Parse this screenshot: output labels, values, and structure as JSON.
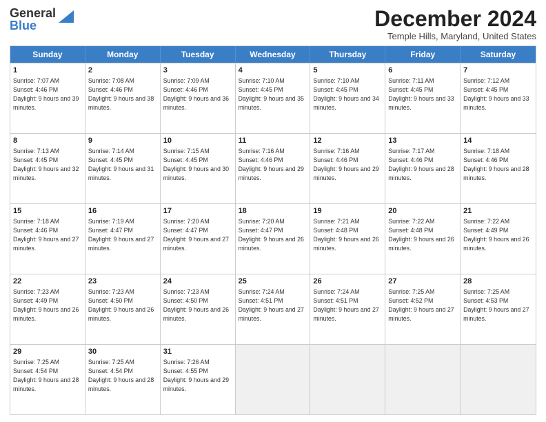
{
  "logo": {
    "general": "General",
    "blue": "Blue"
  },
  "header": {
    "month": "December 2024",
    "location": "Temple Hills, Maryland, United States"
  },
  "weekdays": [
    "Sunday",
    "Monday",
    "Tuesday",
    "Wednesday",
    "Thursday",
    "Friday",
    "Saturday"
  ],
  "weeks": [
    [
      {
        "day": "1",
        "sunrise": "7:07 AM",
        "sunset": "4:46 PM",
        "daylight": "9 hours and 39 minutes."
      },
      {
        "day": "2",
        "sunrise": "7:08 AM",
        "sunset": "4:46 PM",
        "daylight": "9 hours and 38 minutes."
      },
      {
        "day": "3",
        "sunrise": "7:09 AM",
        "sunset": "4:46 PM",
        "daylight": "9 hours and 36 minutes."
      },
      {
        "day": "4",
        "sunrise": "7:10 AM",
        "sunset": "4:45 PM",
        "daylight": "9 hours and 35 minutes."
      },
      {
        "day": "5",
        "sunrise": "7:10 AM",
        "sunset": "4:45 PM",
        "daylight": "9 hours and 34 minutes."
      },
      {
        "day": "6",
        "sunrise": "7:11 AM",
        "sunset": "4:45 PM",
        "daylight": "9 hours and 33 minutes."
      },
      {
        "day": "7",
        "sunrise": "7:12 AM",
        "sunset": "4:45 PM",
        "daylight": "9 hours and 33 minutes."
      }
    ],
    [
      {
        "day": "8",
        "sunrise": "7:13 AM",
        "sunset": "4:45 PM",
        "daylight": "9 hours and 32 minutes."
      },
      {
        "day": "9",
        "sunrise": "7:14 AM",
        "sunset": "4:45 PM",
        "daylight": "9 hours and 31 minutes."
      },
      {
        "day": "10",
        "sunrise": "7:15 AM",
        "sunset": "4:45 PM",
        "daylight": "9 hours and 30 minutes."
      },
      {
        "day": "11",
        "sunrise": "7:16 AM",
        "sunset": "4:46 PM",
        "daylight": "9 hours and 29 minutes."
      },
      {
        "day": "12",
        "sunrise": "7:16 AM",
        "sunset": "4:46 PM",
        "daylight": "9 hours and 29 minutes."
      },
      {
        "day": "13",
        "sunrise": "7:17 AM",
        "sunset": "4:46 PM",
        "daylight": "9 hours and 28 minutes."
      },
      {
        "day": "14",
        "sunrise": "7:18 AM",
        "sunset": "4:46 PM",
        "daylight": "9 hours and 28 minutes."
      }
    ],
    [
      {
        "day": "15",
        "sunrise": "7:18 AM",
        "sunset": "4:46 PM",
        "daylight": "9 hours and 27 minutes."
      },
      {
        "day": "16",
        "sunrise": "7:19 AM",
        "sunset": "4:47 PM",
        "daylight": "9 hours and 27 minutes."
      },
      {
        "day": "17",
        "sunrise": "7:20 AM",
        "sunset": "4:47 PM",
        "daylight": "9 hours and 27 minutes."
      },
      {
        "day": "18",
        "sunrise": "7:20 AM",
        "sunset": "4:47 PM",
        "daylight": "9 hours and 26 minutes."
      },
      {
        "day": "19",
        "sunrise": "7:21 AM",
        "sunset": "4:48 PM",
        "daylight": "9 hours and 26 minutes."
      },
      {
        "day": "20",
        "sunrise": "7:22 AM",
        "sunset": "4:48 PM",
        "daylight": "9 hours and 26 minutes."
      },
      {
        "day": "21",
        "sunrise": "7:22 AM",
        "sunset": "4:49 PM",
        "daylight": "9 hours and 26 minutes."
      }
    ],
    [
      {
        "day": "22",
        "sunrise": "7:23 AM",
        "sunset": "4:49 PM",
        "daylight": "9 hours and 26 minutes."
      },
      {
        "day": "23",
        "sunrise": "7:23 AM",
        "sunset": "4:50 PM",
        "daylight": "9 hours and 26 minutes."
      },
      {
        "day": "24",
        "sunrise": "7:23 AM",
        "sunset": "4:50 PM",
        "daylight": "9 hours and 26 minutes."
      },
      {
        "day": "25",
        "sunrise": "7:24 AM",
        "sunset": "4:51 PM",
        "daylight": "9 hours and 27 minutes."
      },
      {
        "day": "26",
        "sunrise": "7:24 AM",
        "sunset": "4:51 PM",
        "daylight": "9 hours and 27 minutes."
      },
      {
        "day": "27",
        "sunrise": "7:25 AM",
        "sunset": "4:52 PM",
        "daylight": "9 hours and 27 minutes."
      },
      {
        "day": "28",
        "sunrise": "7:25 AM",
        "sunset": "4:53 PM",
        "daylight": "9 hours and 27 minutes."
      }
    ],
    [
      {
        "day": "29",
        "sunrise": "7:25 AM",
        "sunset": "4:54 PM",
        "daylight": "9 hours and 28 minutes."
      },
      {
        "day": "30",
        "sunrise": "7:25 AM",
        "sunset": "4:54 PM",
        "daylight": "9 hours and 28 minutes."
      },
      {
        "day": "31",
        "sunrise": "7:26 AM",
        "sunset": "4:55 PM",
        "daylight": "9 hours and 29 minutes."
      },
      null,
      null,
      null,
      null
    ]
  ]
}
